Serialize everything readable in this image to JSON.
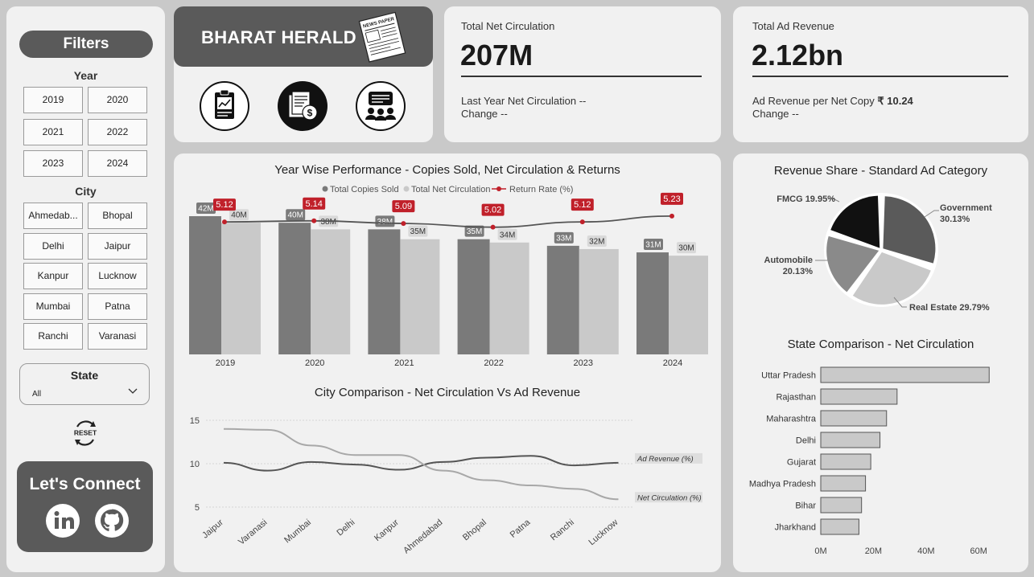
{
  "filters": {
    "title": "Filters",
    "year_label": "Year",
    "years": [
      "2019",
      "2020",
      "2021",
      "2022",
      "2023",
      "2024"
    ],
    "city_label": "City",
    "cities": [
      "Ahmedab...",
      "Bhopal",
      "Delhi",
      "Jaipur",
      "Kanpur",
      "Lucknow",
      "Mumbai",
      "Patna",
      "Ranchi",
      "Varanasi"
    ],
    "state_label": "State",
    "state_value": "All",
    "reset_label": "RESET",
    "connect_title": "Let's Connect"
  },
  "brand": {
    "title": "BHARAT HERALD",
    "icons": [
      "report-icon",
      "finance-icon",
      "team-icon"
    ],
    "newspaper_text": "NEWS PAPER"
  },
  "kpi_circulation": {
    "title": "Total Net Circulation",
    "value": "207M",
    "line1": "Last Year Net Circulation --",
    "line2": "Change --"
  },
  "kpi_revenue": {
    "title": "Total Ad Revenue",
    "value": "2.12bn",
    "line1_prefix": "Ad Revenue per Net Copy ",
    "line1_value": "₹ 10.24",
    "line2": "Change --"
  },
  "chart_data": [
    {
      "type": "bar",
      "title": "Year Wise Performance - Copies Sold, Net Circulation & Returns",
      "categories": [
        "2019",
        "2020",
        "2021",
        "2022",
        "2023",
        "2024"
      ],
      "legend": [
        "Total Copies Sold",
        "Total Net Circulation",
        "Return Rate (%)"
      ],
      "series": [
        {
          "name": "Total Copies Sold",
          "values": [
            42,
            40,
            38,
            35,
            33,
            31
          ],
          "labels": [
            "42M",
            "40M",
            "38M",
            "35M",
            "33M",
            "31M"
          ],
          "color": "#7a7a7a"
        },
        {
          "name": "Total Net Circulation",
          "values": [
            40,
            38,
            35,
            34,
            32,
            30
          ],
          "labels": [
            "40M",
            "38M",
            "35M",
            "34M",
            "32M",
            "30M"
          ],
          "color": "#c9c9c9"
        },
        {
          "name": "Return Rate (%)",
          "values": [
            5.12,
            5.14,
            5.09,
            5.02,
            5.12,
            5.23
          ],
          "labels": [
            "5.12",
            "5.14",
            "5.09",
            "5.02",
            "5.12",
            "5.23"
          ],
          "color": "#c0202a"
        }
      ]
    },
    {
      "type": "line",
      "title": "City Comparison - Net Circulation Vs Ad Revenue",
      "categories": [
        "Jaipur",
        "Varanasi",
        "Mumbai",
        "Delhi",
        "Kanpur",
        "Ahmedabad",
        "Bhopal",
        "Patna",
        "Ranchi",
        "Lucknow"
      ],
      "yticks": [
        "15",
        "10",
        "5"
      ],
      "ylim": [
        5,
        15
      ],
      "series": [
        {
          "name": "Ad Revenue (%)",
          "values": [
            10.1,
            9.2,
            10.2,
            9.9,
            9.3,
            10.2,
            10.7,
            10.9,
            9.8,
            10.1
          ],
          "color": "#555555"
        },
        {
          "name": "Net Circulation (%)",
          "values": [
            14.0,
            13.9,
            12.1,
            11.0,
            11.0,
            9.2,
            8.1,
            7.5,
            7.1,
            5.9
          ],
          "color": "#a8a8a8"
        }
      ]
    },
    {
      "type": "pie",
      "title": "Revenue Share - Standard Ad Category",
      "slices": [
        {
          "name": "Government",
          "value": 30.13,
          "label": "Government",
          "pct": "30.13%",
          "color": "#5a5a5a"
        },
        {
          "name": "Real Estate",
          "value": 29.79,
          "label": "Real Estate 29.79%",
          "color": "#c9c9c9"
        },
        {
          "name": "Automobile",
          "value": 20.13,
          "label": "Automobile",
          "pct": "20.13%",
          "color": "#8a8a8a"
        },
        {
          "name": "FMCG",
          "value": 19.95,
          "label": "FMCG 19.95%",
          "color": "#111111"
        }
      ]
    },
    {
      "type": "bar",
      "orientation": "horizontal",
      "title": "State Comparison - Net Circulation",
      "categories": [
        "Uttar Pradesh",
        "Rajasthan",
        "Maharashtra",
        "Delhi",
        "Gujarat",
        "Madhya Pradesh",
        "Bihar",
        "Jharkhand"
      ],
      "values": [
        64,
        29,
        25,
        22.5,
        19,
        17,
        15.5,
        14.5
      ],
      "xticks": [
        "0M",
        "20M",
        "40M",
        "60M"
      ],
      "xlim": [
        0,
        60
      ],
      "color": "#c9c9c9"
    }
  ]
}
